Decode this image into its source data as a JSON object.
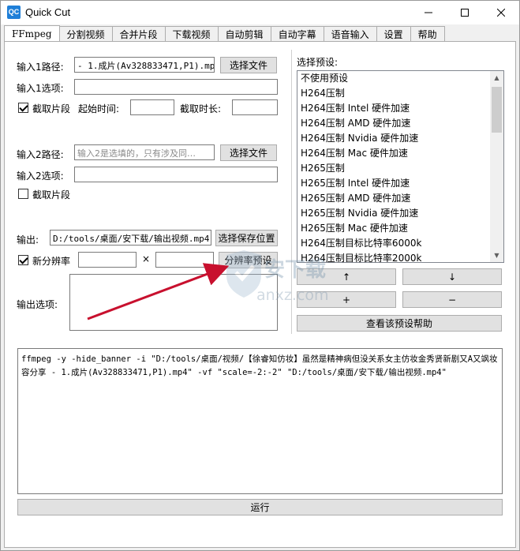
{
  "window": {
    "title": "Quick Cut",
    "icon_text": "QC",
    "controls": [
      "minimize-icon",
      "maximize-icon",
      "close-icon"
    ]
  },
  "tabs": [
    {
      "label": "FFmpeg",
      "active": true
    },
    {
      "label": "分割视频"
    },
    {
      "label": "合并片段"
    },
    {
      "label": "下载视频"
    },
    {
      "label": "自动剪辑"
    },
    {
      "label": "自动字幕"
    },
    {
      "label": "语音输入"
    },
    {
      "label": "设置"
    },
    {
      "label": "帮助"
    }
  ],
  "input1": {
    "path_label": "输入1路径:",
    "path_value": "- 1.成片(Av328833471,P1).mp4",
    "choose_btn": "选择文件",
    "options_label": "输入1选项:",
    "options_value": "",
    "clip_label": "截取片段",
    "clip_checked": true,
    "start_label": "起始时间:",
    "start_value": "",
    "duration_label": "截取时长:",
    "duration_value": ""
  },
  "input2": {
    "path_label": "输入2路径:",
    "path_placeholder": "输入2是选填的，只有涉及同…",
    "choose_btn": "选择文件",
    "options_label": "输入2选项:",
    "options_value": "",
    "clip_label": "截取片段",
    "clip_checked": false
  },
  "output": {
    "label": "输出:",
    "value": "D:/tools/桌面/安下载/输出视频.mp4",
    "choose_btn": "选择保存位置",
    "resolution_label": "新分辨率",
    "resolution_checked": true,
    "width_value": "",
    "times": "×",
    "height_value": "",
    "preset_btn": "分辨率预设",
    "options_label": "输出选项:",
    "options_value": ""
  },
  "presets": {
    "label": "选择预设:",
    "items": [
      "不使用预设",
      "H264压制",
      "H264压制 Intel 硬件加速",
      "H264压制 AMD 硬件加速",
      "H264压制 Nvidia 硬件加速",
      "H264压制 Mac 硬件加速",
      "H265压制",
      "H265压制 Intel 硬件加速",
      "H265压制 AMD 硬件加速",
      "H265压制 Nvidia 硬件加速",
      "H265压制 Mac 硬件加速",
      "H264压制目标比特率6000k",
      "H264压制目标比特率2000k"
    ],
    "up_btn": "↑",
    "down_btn": "↓",
    "add_btn": "+",
    "remove_btn": "−",
    "help_btn": "查看该预设帮助"
  },
  "command": {
    "text": "ffmpeg -y -hide_banner -i \"D:/tools/桌面/视频/【徐睿知仿妆】虽然是精神病但没关系女主仿妆金秀贤新剧又A又飒妆容分享 - 1.成片(Av328833471,P1).mp4\" -vf \"scale=-2:-2\" \"D:/tools/桌面/安下载/输出视频.mp4\""
  },
  "run_btn": "运行",
  "watermark": {
    "text": "安下载",
    "sub": "anxz.com"
  },
  "colors": {
    "annotation_arrow": "#c8102e",
    "app_icon": "#1f7fd8"
  }
}
